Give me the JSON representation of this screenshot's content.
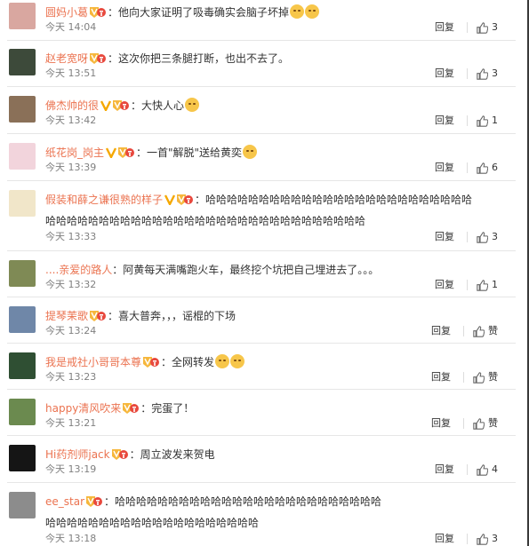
{
  "comments": [
    {
      "user": "圆妈小葛",
      "badges": [
        "vip"
      ],
      "text": "：他向大家证明了吸毒确实会脑子坏掉",
      "emojis": 2,
      "time": "今天 14:04",
      "reply": "回复",
      "likes": "3",
      "avatar_color": "#d9a7a0"
    },
    {
      "user": "赵老宽呀",
      "badges": [
        "vip"
      ],
      "text": "：这次你把三条腿打断，也出不去了。",
      "emojis": 0,
      "time": "今天 13:51",
      "reply": "回复",
      "likes": "3",
      "avatar_color": "#3d4a3a"
    },
    {
      "user": "佛杰帅的很",
      "badges": [
        "yellow-v",
        "vip"
      ],
      "text": "：大快人心",
      "emojis": 1,
      "time": "今天 13:42",
      "reply": "回复",
      "likes": "1",
      "avatar_color": "#8a7058"
    },
    {
      "user": "纸花岗_岗主",
      "badges": [
        "yellow-v",
        "vip"
      ],
      "text": "：一首\"解脱\"送给黄奕",
      "emojis": 1,
      "time": "今天 13:39",
      "reply": "回复",
      "likes": "6",
      "avatar_color": "#f2d4dc"
    },
    {
      "user": "假装和薛之谦很熟的样子",
      "badges": [
        "yellow-v",
        "vip"
      ],
      "text": "：哈哈哈哈哈哈哈哈哈哈哈哈哈哈哈哈哈哈哈哈哈哈哈哈哈",
      "text2": "哈哈哈哈哈哈哈哈哈哈哈哈哈哈哈哈哈哈哈哈哈哈哈哈哈哈哈哈哈哈",
      "emojis": 0,
      "time": "今天 13:33",
      "reply": "回复",
      "likes": "3",
      "avatar_color": "#f1e6c9"
    },
    {
      "user": "....亲爱的路人",
      "badges": [],
      "text": "：阿黄每天满嘴跑火车，最终挖个坑把自己埋进去了。。。",
      "emojis": 0,
      "time": "今天 13:32",
      "reply": "回复",
      "likes": "1",
      "avatar_color": "#7f8a55"
    },
    {
      "user": "提琴茉歌",
      "badges": [
        "vip"
      ],
      "text": "：喜大普奔，，，谣棍的下场",
      "emojis": 0,
      "time": "今天 13:24",
      "reply": "回复",
      "likes": "赞",
      "avatar_color": "#6f87a8"
    },
    {
      "user": "我是戒社小哥哥本尊",
      "badges": [
        "vip"
      ],
      "text": "：全网转发",
      "emojis": 2,
      "time": "今天 13:23",
      "reply": "回复",
      "likes": "赞",
      "avatar_color": "#2f4f33"
    },
    {
      "user": "happy清风吹来",
      "badges": [
        "vip"
      ],
      "text": "：完蛋了！",
      "emojis": 0,
      "time": "今天 13:21",
      "reply": "回复",
      "likes": "赞",
      "avatar_color": "#6b8a4f"
    },
    {
      "user": "Hi药剂师jack",
      "badges": [
        "vip"
      ],
      "text": "：周立波发来贺电",
      "emojis": 0,
      "time": "今天 13:19",
      "reply": "回复",
      "likes": "4",
      "avatar_color": "#151515"
    },
    {
      "user": "ee_star",
      "badges": [
        "vip"
      ],
      "text": "：哈哈哈哈哈哈哈哈哈哈哈哈哈哈哈哈哈哈哈哈哈哈哈哈哈",
      "text2": "哈哈哈哈哈哈哈哈哈哈哈哈哈哈哈哈哈哈哈哈",
      "emojis": 0,
      "time": "今天 13:18",
      "reply": "回复",
      "likes": "3",
      "avatar_color": "#8c8c8c"
    }
  ]
}
